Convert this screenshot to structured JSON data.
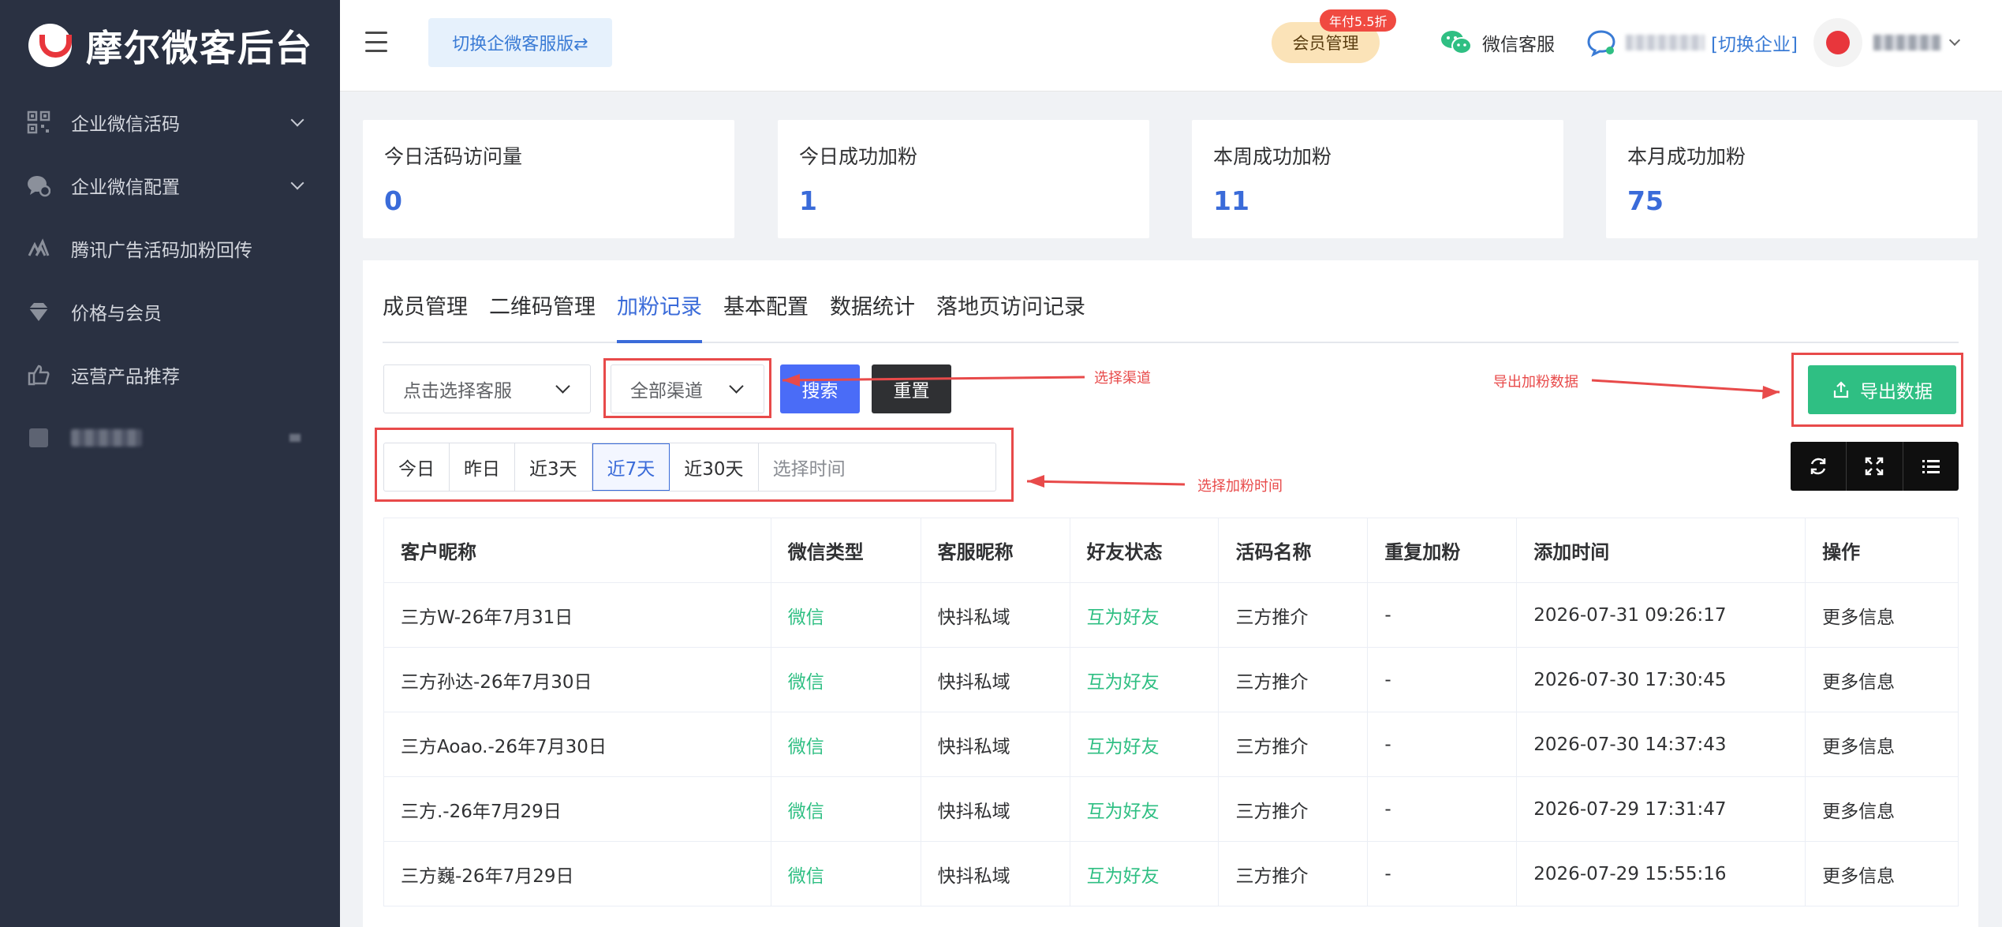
{
  "brand": {
    "title": "摩尔微客后台"
  },
  "sidebar": {
    "items": [
      {
        "label": "企业微信活码",
        "icon": "qrcode-icon",
        "expandable": true
      },
      {
        "label": "企业微信配置",
        "icon": "chat-gear-icon",
        "expandable": true
      },
      {
        "label": "腾讯广告活码加粉回传",
        "icon": "ad-icon",
        "expandable": false
      },
      {
        "label": "价格与会员",
        "icon": "diamond-icon",
        "expandable": false
      },
      {
        "label": "运营产品推荐",
        "icon": "thumbs-up-icon",
        "expandable": false
      }
    ]
  },
  "header": {
    "switch_label": "切换企微客服版⇄",
    "member_label": "会员管理",
    "member_badge": "年付5.5折",
    "wechat_kf": "微信客服",
    "switch_company": "[切换企业]"
  },
  "stats": [
    {
      "label": "今日活码访问量",
      "value": "0"
    },
    {
      "label": "今日成功加粉",
      "value": "1"
    },
    {
      "label": "本周成功加粉",
      "value": "11"
    },
    {
      "label": "本月成功加粉",
      "value": "75"
    }
  ],
  "tabs": [
    "成员管理",
    "二维码管理",
    "加粉记录",
    "基本配置",
    "数据统计",
    "落地页访问记录"
  ],
  "active_tab": 2,
  "filters": {
    "staff_placeholder": "点击选择客服",
    "channel_value": "全部渠道",
    "search_label": "搜索",
    "reset_label": "重置",
    "export_label": "导出数据",
    "date_options": [
      "今日",
      "昨日",
      "近3天",
      "近7天",
      "近30天"
    ],
    "date_active": 3,
    "date_placeholder": "选择时间"
  },
  "annotations": {
    "channel": "选择渠道",
    "export": "导出加粉数据",
    "time": "选择加粉时间"
  },
  "table": {
    "columns": [
      "客户昵称",
      "微信类型",
      "客服昵称",
      "好友状态",
      "活码名称",
      "重复加粉",
      "添加时间",
      "操作"
    ],
    "rows": [
      [
        "三方W-26年7月31日",
        "微信",
        "快抖私域",
        "互为好友",
        "三方推介",
        "-",
        "2026-07-31 09:26:17",
        "更多信息"
      ],
      [
        "三方孙达-26年7月30日",
        "微信",
        "快抖私域",
        "互为好友",
        "三方推介",
        "-",
        "2026-07-30 17:30:45",
        "更多信息"
      ],
      [
        "三方Aoao.-26年7月30日",
        "微信",
        "快抖私域",
        "互为好友",
        "三方推介",
        "-",
        "2026-07-30 14:37:43",
        "更多信息"
      ],
      [
        "三方.-26年7月29日",
        "微信",
        "快抖私域",
        "互为好友",
        "三方推介",
        "-",
        "2026-07-29 17:31:47",
        "更多信息"
      ],
      [
        "三方巍-26年7月29日",
        "微信",
        "快抖私域",
        "互为好友",
        "三方推介",
        "-",
        "2026-07-29 15:55:16",
        "更多信息"
      ]
    ]
  },
  "colors": {
    "sidebar_bg": "#2a3142",
    "accent_blue": "#3a6bd9",
    "green": "#2fbf83",
    "annotation_red": "#e84a4a"
  }
}
